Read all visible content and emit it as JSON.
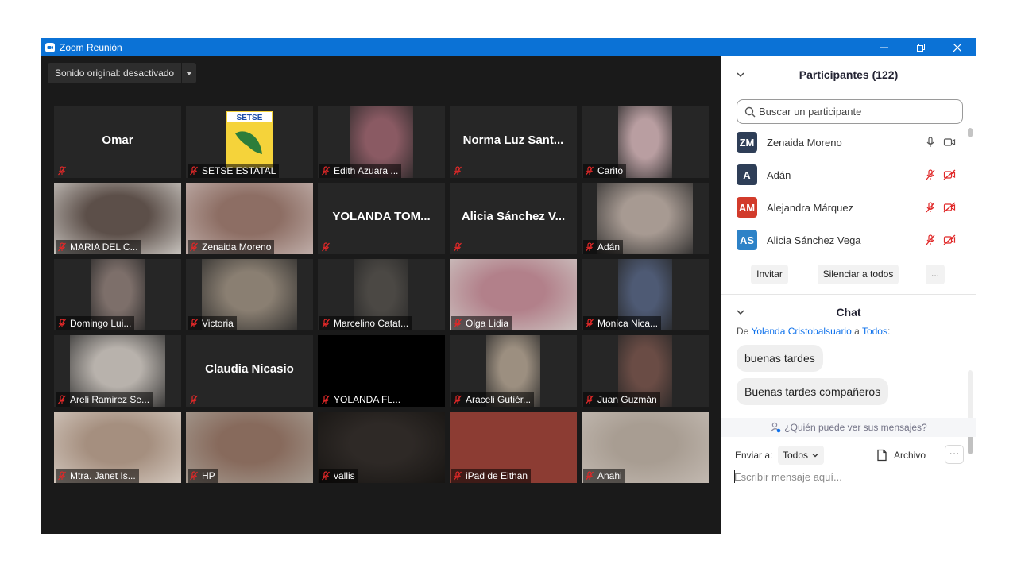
{
  "window": {
    "title": "Zoom Reunión"
  },
  "toolbar": {
    "original_sound": "Sonido original: desactivado"
  },
  "tiles": [
    {
      "name": "",
      "big_name": "Omar",
      "bg": "#262626"
    },
    {
      "name": "SETSE ESTATAL",
      "big_name": "",
      "bg": "#262626",
      "logo_text": "SETSE"
    },
    {
      "name": "Edith Azuara ...",
      "big_name": "",
      "bg": "#262626",
      "photo": "#8a5a63"
    },
    {
      "name": "",
      "big_name": "Norma Luz Sant...",
      "bg": "#262626"
    },
    {
      "name": "Carito",
      "big_name": "",
      "bg": "#262626",
      "photo": "#b99ea1"
    },
    {
      "name": "MARIA DEL C...",
      "big_name": "",
      "bg": "#d7d4cf",
      "photo": "#5c4f49"
    },
    {
      "name": "Zenaida Moreno",
      "big_name": "",
      "bg": "#c7b7b3",
      "photo": "#8d6e64"
    },
    {
      "name": "",
      "big_name": "YOLANDA TOM...",
      "bg": "#262626"
    },
    {
      "name": "",
      "big_name": "Alicia Sánchez V...",
      "bg": "#262626"
    },
    {
      "name": "Adán",
      "big_name": "",
      "bg": "#262626",
      "photo": "#a79a92"
    },
    {
      "name": "Domingo Lui...",
      "big_name": "",
      "bg": "#262626",
      "photo": "#7d6f6a"
    },
    {
      "name": "Victoria",
      "big_name": "",
      "bg": "#262626",
      "photo": "#8a7f72"
    },
    {
      "name": "Marcelino Catat...",
      "big_name": "",
      "bg": "#262626",
      "photo": "#4b4844"
    },
    {
      "name": "Olga Lidia",
      "big_name": "",
      "bg": "#cfcac6",
      "photo": "#b2808a"
    },
    {
      "name": "Monica Nica...",
      "big_name": "",
      "bg": "#262626",
      "photo": "#4e5a74"
    },
    {
      "name": "Areli Ramirez Se...",
      "big_name": "",
      "bg": "#262626",
      "photo": "#b8b2ac"
    },
    {
      "name": "",
      "big_name": "Claudia Nicasio",
      "bg": "#262626"
    },
    {
      "name": "YOLANDA FL...",
      "big_name": "",
      "bg": "#000000"
    },
    {
      "name": "Araceli Gutiér...",
      "big_name": "",
      "bg": "#262626",
      "photo": "#9c8f80"
    },
    {
      "name": "Juan Guzmán",
      "big_name": "",
      "bg": "#262626",
      "photo": "#6a4c45"
    },
    {
      "name": "Mtra. Janet Is...",
      "big_name": "",
      "bg": "#d9cfc6",
      "photo": "#a58f7f"
    },
    {
      "name": "HP",
      "big_name": "",
      "bg": "#a9a197",
      "photo": "#876a5c"
    },
    {
      "name": "vallis",
      "big_name": "",
      "bg": "#141210",
      "photo": "#2e2926"
    },
    {
      "name": "iPad de Eithan",
      "big_name": "",
      "bg": "#8c3c33",
      "photo": "#8c3c33"
    },
    {
      "name": "Anahi",
      "big_name": "",
      "bg": "#c6bdb5",
      "photo": "#a89d92"
    }
  ],
  "participants": {
    "title": "Participantes (122)",
    "search_placeholder": "Buscar un participante",
    "list": [
      {
        "initials": "ZM",
        "name": "Zenaida Moreno",
        "color": "#2e3e57",
        "muted": false
      },
      {
        "initials": "A",
        "name": "Adán",
        "color": "#2e3e57",
        "muted": true
      },
      {
        "initials": "AM",
        "name": "Alejandra Márquez",
        "color": "#d23b2b",
        "muted": true
      },
      {
        "initials": "AS",
        "name": "Alicia Sánchez Vega",
        "color": "#2d82c7",
        "muted": true
      }
    ],
    "invite": "Invitar",
    "mute_all": "Silenciar a todos",
    "more": "..."
  },
  "chat": {
    "title": "Chat",
    "from_prefix": "De",
    "from_name": "Yolanda Cristobalsuario",
    "to_word": "a",
    "to_name": "Todos",
    "messages": [
      "buenas tardes",
      "Buenas tardes compañeros"
    ],
    "who_can_see": "¿Quién puede ver sus mensajes?",
    "send_to_label": "Enviar a:",
    "recipient": "Todos",
    "file": "Archivo",
    "more": "···",
    "input_placeholder": "Escribir mensaje aquí..."
  }
}
